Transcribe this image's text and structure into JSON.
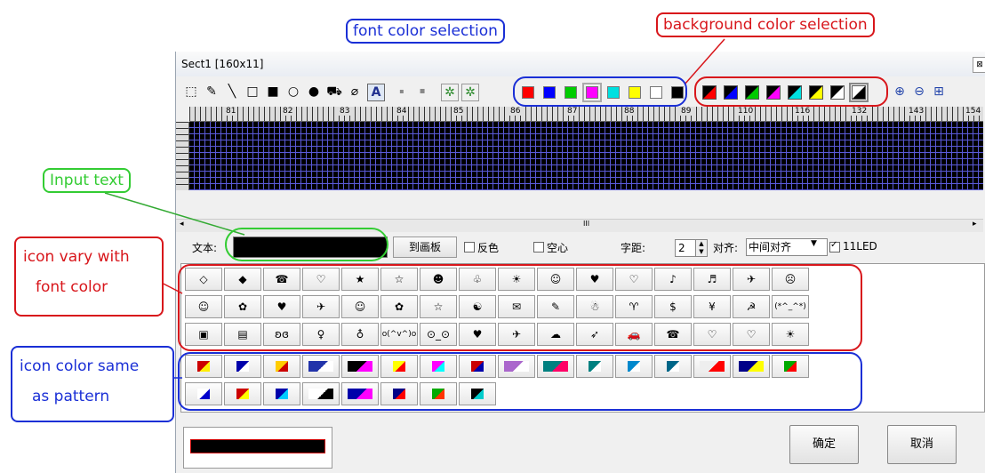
{
  "window": {
    "title": "Sect1 [160x11]",
    "close_glyph": "⊠"
  },
  "annotations": {
    "font_color": "font color selection",
    "bg_color": "background color selection",
    "input_text": "Input text",
    "icon_vary_1": "icon vary with",
    "icon_vary_2": "font color",
    "icon_same_1": "icon color same",
    "icon_same_2": "as pattern"
  },
  "toolbar": {
    "tools": [
      {
        "icon": "select-rect-icon",
        "glyph": "⬚"
      },
      {
        "icon": "pen-icon",
        "glyph": "✎"
      },
      {
        "icon": "line-icon",
        "glyph": "╲"
      },
      {
        "icon": "rect-outline-icon",
        "glyph": "□"
      },
      {
        "icon": "rect-filled-icon",
        "glyph": "■"
      },
      {
        "icon": "ellipse-outline-icon",
        "glyph": "○"
      },
      {
        "icon": "ellipse-filled-icon",
        "glyph": "●"
      },
      {
        "icon": "fill-bucket-icon",
        "glyph": "⛟"
      },
      {
        "icon": "eraser-icon",
        "glyph": "⌀"
      },
      {
        "icon": "text-tool-icon",
        "glyph": "A"
      },
      {
        "icon": "dot-small-icon",
        "glyph": "▪"
      },
      {
        "icon": "dot-large-icon",
        "glyph": "▪"
      },
      {
        "icon": "effect1-icon",
        "glyph": "✲"
      },
      {
        "icon": "effect2-icon",
        "glyph": "✲"
      }
    ],
    "font_colors": [
      "#ff0000",
      "#0000ff",
      "#00cc00",
      "#ff00ff",
      "#00e0e0",
      "#ffff00",
      "#ffffff",
      "#000000"
    ],
    "bg_colors": [
      "#ff0000",
      "#0000ff",
      "#00cc00",
      "#ff00ff",
      "#00e0e0",
      "#ffff00",
      "#ffffff",
      "#000000"
    ],
    "zoom_tools": [
      {
        "icon": "zoom-in-icon",
        "glyph": "⊕"
      },
      {
        "icon": "zoom-out-icon",
        "glyph": "⊖"
      },
      {
        "icon": "zoom-fit-icon",
        "glyph": "⊞"
      }
    ]
  },
  "ruler": {
    "labels": [
      "81",
      "82",
      "83",
      "84",
      "85",
      "86",
      "87",
      "88",
      "89",
      "110",
      "116",
      "132",
      "143",
      "154"
    ]
  },
  "editor": {
    "text_label": "文本:",
    "text_value": "",
    "to_board": "到画板",
    "invert": "反色",
    "hollow": "空心",
    "spacing_label": "字距:",
    "spacing_value": "2",
    "align_label": "对齐:",
    "align_value": "中间对齐",
    "led_check": "11LED",
    "scroll_mark": "III"
  },
  "symbols_row1": [
    "◇",
    "◆",
    "☎",
    "♡",
    "★",
    "☆",
    "☻",
    "♧",
    "☀",
    "☺",
    "♥",
    "♡",
    "♪",
    "♬",
    "✈",
    "☹"
  ],
  "symbols_row2": [
    "☺",
    "✿",
    "♥",
    "✈",
    "☺",
    "✿",
    "☆",
    "☯",
    "✉",
    "✎",
    "☃",
    "♈",
    "$",
    "¥",
    "☭",
    "(*^_^*)"
  ],
  "symbols_row3": [
    "▣",
    "▤",
    "ʚɞ",
    "♀",
    "♁",
    "o(^v^)o",
    "⊙_⊙",
    "♥",
    "✈",
    "☁",
    "➶",
    "🚗",
    "☎",
    "♡",
    "♡",
    "☀"
  ],
  "patterns_row1": [
    [
      "#cc0000",
      "#ffee00"
    ],
    [
      "#0000aa",
      "#ffffff"
    ],
    [
      "#ffcc00",
      "#cc0000"
    ],
    [
      "#2233aa",
      "#ffffff"
    ],
    [
      "#000000",
      "#ff00ff"
    ],
    [
      "#ffff00",
      "#ff0000"
    ],
    [
      "#ff00ff",
      "#00ffff"
    ],
    [
      "#cc0000",
      "#0000aa"
    ],
    [
      "#aa66cc",
      "#ffffff"
    ],
    [
      "#008080",
      "#ff0066"
    ],
    [
      "#008080",
      "#ffffff"
    ],
    [
      "#0088cc",
      "#ffffff"
    ],
    [
      "#006688",
      "#ffffff"
    ],
    [
      "#eeeeee",
      "#ff0000"
    ],
    [
      "#000088",
      "#ffff00"
    ],
    [
      "#00aa00",
      "#ff0000"
    ]
  ],
  "patterns_row2": [
    [
      "#ffffff",
      "#0000cc"
    ],
    [
      "#cc0000",
      "#ffff00"
    ],
    [
      "#0000aa",
      "#00ccff"
    ],
    [
      "#ffffff",
      "#000000"
    ],
    [
      "#0000aa",
      "#ff00ff"
    ],
    [
      "#000088",
      "#ff0000"
    ],
    [
      "#00aa00",
      "#ff3300"
    ],
    [
      "#000000",
      "#00cccc"
    ]
  ],
  "buttons": {
    "ok": "确定",
    "cancel": "取消"
  },
  "colors": {
    "grid_bg": "#000000",
    "grid_line": "#5a5ad8",
    "blue_ann": "#1a2fd6",
    "red_ann": "#d8161b",
    "green_ann": "#33cc33"
  }
}
